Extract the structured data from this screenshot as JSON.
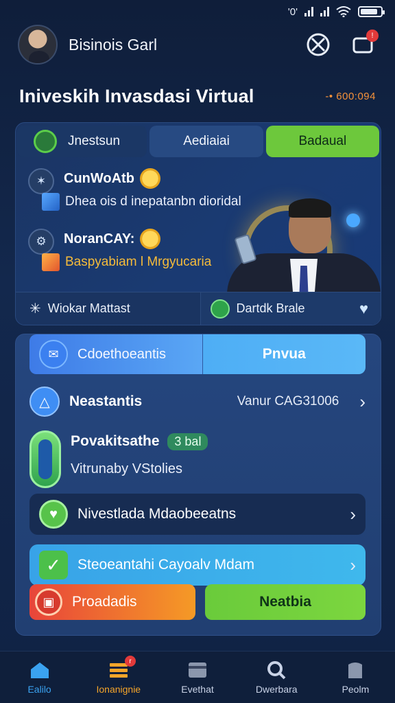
{
  "status_bar": {
    "network": "'0'",
    "battery_level": 0.85
  },
  "header": {
    "user_name": "Bisinois Garl"
  },
  "title": {
    "text": "Iniveskih Invasdasi Virtual",
    "value": "-• 600:094"
  },
  "tabs": [
    {
      "label": "Jnestsun"
    },
    {
      "label": "Aediaiai"
    },
    {
      "label": "Badaual"
    }
  ],
  "features": [
    {
      "title": "CunWoAtb",
      "subtitle": "Dhea ois d inepatanbn dioridal"
    },
    {
      "title": "NoranCAY:",
      "subtitle": "Baspyabiam l Mrgyucaria"
    }
  ],
  "card1_bottom": {
    "left": "Wiokar Mattast",
    "right": "Dartdk Brale"
  },
  "card2": {
    "btn_primary": "Cdoethoeantis",
    "btn_secondary": "Pnvua",
    "row1": {
      "label": "Neastantis",
      "value": "Vanur CAG31006"
    },
    "row2": {
      "label": "Povakitsathe",
      "tag": "3 bal",
      "sub": "Vitrunaby VStolies"
    },
    "row3": {
      "label": "Nivestlada Mdaobeeatns"
    },
    "row4": {
      "label": "Steoeantahi Cayoalv Mdam"
    },
    "btn_orange": "Proadadis",
    "btn_green": "Neatbia"
  },
  "navbar": [
    {
      "label": "Ealilo",
      "icon": "home-icon"
    },
    {
      "label": "Ionanignie",
      "icon": "menu-icon",
      "badge": "r"
    },
    {
      "label": "Evethat",
      "icon": "card-icon"
    },
    {
      "label": "Dwerbara",
      "icon": "search-icon"
    },
    {
      "label": "Peolm",
      "icon": "profile-icon"
    }
  ],
  "colors": {
    "accent_green": "#6dc83c",
    "accent_blue": "#3aa2f0",
    "accent_orange": "#f5a52a",
    "badge_red": "#e23a3a"
  }
}
